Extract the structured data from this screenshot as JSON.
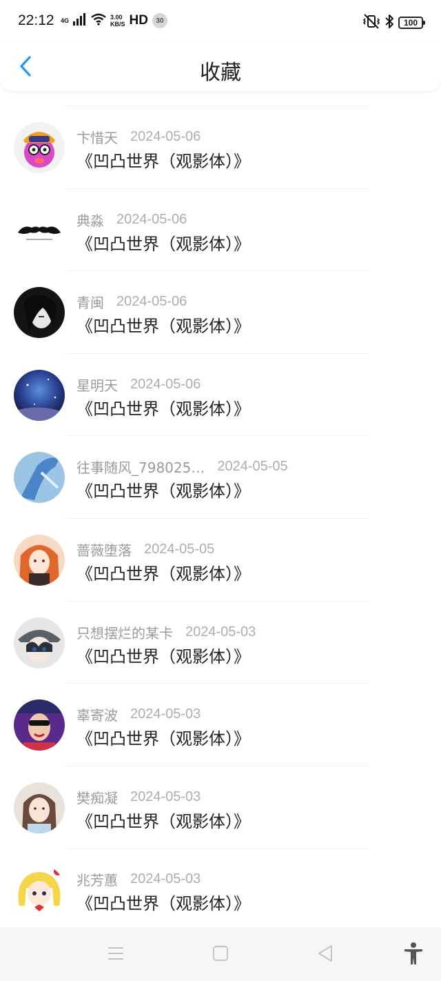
{
  "status_bar": {
    "time": "22:12",
    "network": "4G",
    "speed_value": "3.00",
    "speed_unit": "KB/S",
    "hd": "HD",
    "notification_count": "30",
    "battery": "100",
    "icons": [
      "signal-icon",
      "wifi-icon",
      "vibrate-off-icon",
      "bluetooth-icon",
      "battery-icon"
    ]
  },
  "header": {
    "title": "收藏",
    "back_icon": "chevron-left-icon",
    "accent_color": "#2196f3"
  },
  "favorites": [
    {
      "user": "卞惜天",
      "date": "2024-05-06",
      "title": "《凹凸世界（观影体）》"
    },
    {
      "user": "典淼",
      "date": "2024-05-06",
      "title": "《凹凸世界（观影体）》"
    },
    {
      "user": "青闽",
      "date": "2024-05-06",
      "title": "《凹凸世界（观影体）》"
    },
    {
      "user": "星明天",
      "date": "2024-05-06",
      "title": "《凹凸世界（观影体）》"
    },
    {
      "user": "往事随风_798025…",
      "date": "2024-05-05",
      "title": "《凹凸世界（观影体）》"
    },
    {
      "user": "蔷薇堕落",
      "date": "2024-05-05",
      "title": "《凹凸世界（观影体）》"
    },
    {
      "user": "只想摆烂的某卡",
      "date": "2024-05-03",
      "title": "《凹凸世界（观影体）》"
    },
    {
      "user": "辜寄波",
      "date": "2024-05-03",
      "title": "《凹凸世界（观影体）》"
    },
    {
      "user": "樊痴凝",
      "date": "2024-05-03",
      "title": "《凹凸世界（观影体）》"
    },
    {
      "user": "兆芳蕙",
      "date": "2024-05-03",
      "title": "《凹凸世界（观影体）》"
    }
  ],
  "nav_bar": {
    "icons": [
      "menu-icon",
      "home-square-icon",
      "back-triangle-icon",
      "accessibility-icon"
    ]
  }
}
